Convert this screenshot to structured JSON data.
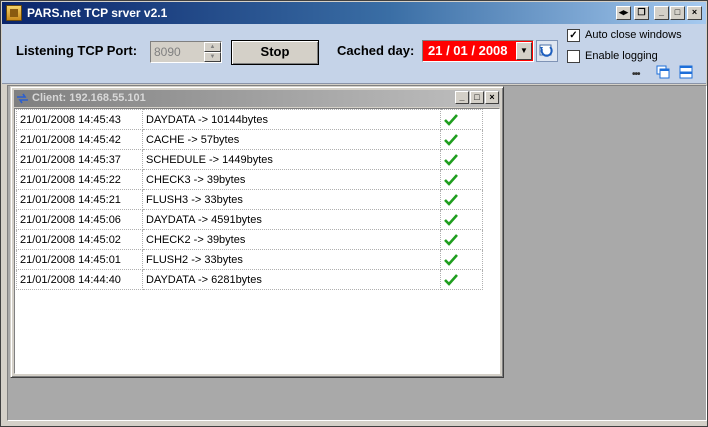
{
  "window": {
    "title": "PARS.net TCP srver v2.1",
    "caption_buttons": [
      "restore-left",
      "restore-right",
      "minimize",
      "maximize",
      "close"
    ]
  },
  "toolbar": {
    "port_label": "Listening TCP Port:",
    "port_value": "8090",
    "stop_label": "Stop",
    "cached_label": "Cached day:",
    "cached_date": "21 / 01 / 2008",
    "auto_close_label": "Auto close windows",
    "auto_close_checked": true,
    "logging_label": "Enable logging",
    "logging_checked": false,
    "dots": "•••"
  },
  "colors": {
    "date_bg": "#ff0000",
    "toolbar_bg": "#c5d3e8",
    "check_green": "#1f9e1f"
  },
  "client": {
    "title": "Client: 192.168.55.101",
    "rows": [
      {
        "time": "21/01/2008 14:45:43",
        "message": "DAYDATA -> 10144bytes",
        "status": "check-icon"
      },
      {
        "time": "21/01/2008 14:45:42",
        "message": "CACHE -> 57bytes",
        "status": "check-icon"
      },
      {
        "time": "21/01/2008 14:45:37",
        "message": "SCHEDULE -> 1449bytes",
        "status": "check-icon"
      },
      {
        "time": "21/01/2008 14:45:22",
        "message": "CHECK3 -> 39bytes",
        "status": "check-icon"
      },
      {
        "time": "21/01/2008 14:45:21",
        "message": "FLUSH3 -> 33bytes",
        "status": "check-icon"
      },
      {
        "time": "21/01/2008 14:45:06",
        "message": "DAYDATA -> 4591bytes",
        "status": "check-icon"
      },
      {
        "time": "21/01/2008 14:45:02",
        "message": "CHECK2 -> 39bytes",
        "status": "check-icon"
      },
      {
        "time": "21/01/2008 14:45:01",
        "message": "FLUSH2 -> 33bytes",
        "status": "check-icon"
      },
      {
        "time": "21/01/2008 14:44:40",
        "message": "DAYDATA -> 6281bytes",
        "status": "check-icon"
      }
    ]
  }
}
